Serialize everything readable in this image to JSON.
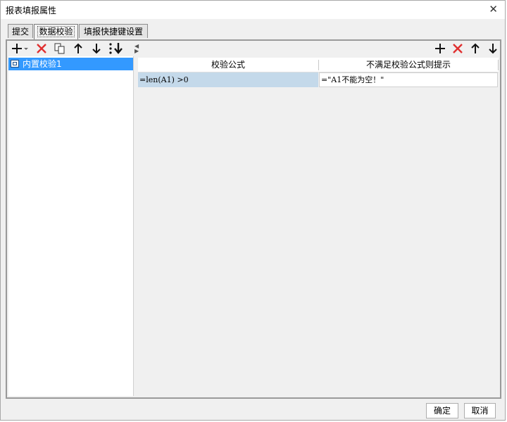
{
  "window": {
    "title": "报表填报属性",
    "close_symbol": "✕"
  },
  "tabs": [
    {
      "label": "提交",
      "active": false
    },
    {
      "label": "数据校验",
      "active": true
    },
    {
      "label": "填报快捷键设置",
      "active": false
    }
  ],
  "left_toolbar": {
    "icons": [
      "add-dropdown-icon",
      "delete-icon",
      "copy-icon",
      "move-up-icon",
      "move-down-icon",
      "move-bottom-icon"
    ]
  },
  "right_toolbar": {
    "icons": [
      "add-icon",
      "delete-icon",
      "move-up-icon",
      "move-down-icon"
    ]
  },
  "tree": {
    "items": [
      {
        "label": "内置校验1",
        "selected": true
      }
    ]
  },
  "grid": {
    "headers": [
      "校验公式",
      "不满足校验公式则提示"
    ],
    "rows": [
      {
        "formula": "=len(A1) >0",
        "message": "=\"A1不能为空！\""
      }
    ]
  },
  "footer": {
    "ok_label": "确定",
    "cancel_label": "取消"
  },
  "colors": {
    "selection": "#3399ff",
    "row_highlight": "#c4d9ea",
    "delete_red": "#e03030"
  }
}
